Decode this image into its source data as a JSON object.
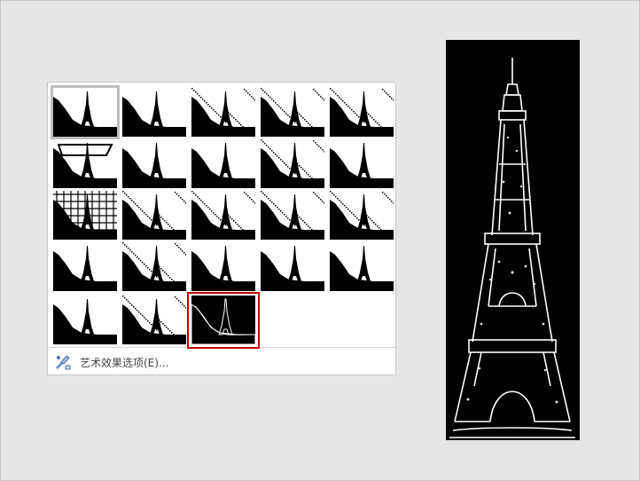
{
  "gallery": {
    "options_label": "艺术效果选项(E)..."
  },
  "effects": [
    {
      "name": "none"
    },
    {
      "name": "marker"
    },
    {
      "name": "pencil-grayscale"
    },
    {
      "name": "pencil-sketch"
    },
    {
      "name": "line-drawing"
    },
    {
      "name": "chalk-sketch"
    },
    {
      "name": "paint-strokes"
    },
    {
      "name": "paint-brush"
    },
    {
      "name": "glow-diffused"
    },
    {
      "name": "blur"
    },
    {
      "name": "light-screen"
    },
    {
      "name": "watercolor-sponge"
    },
    {
      "name": "film-grain"
    },
    {
      "name": "mosaic-bubbles"
    },
    {
      "name": "glass"
    },
    {
      "name": "cement"
    },
    {
      "name": "texturizer"
    },
    {
      "name": "crisscross-etching"
    },
    {
      "name": "pastels-smooth"
    },
    {
      "name": "plastic-wrap"
    },
    {
      "name": "cutout"
    },
    {
      "name": "photocopy"
    },
    {
      "name": "glow-edges"
    }
  ],
  "colors": {
    "selected_border": "#c00000",
    "hover_border": "#bdbdbd"
  }
}
